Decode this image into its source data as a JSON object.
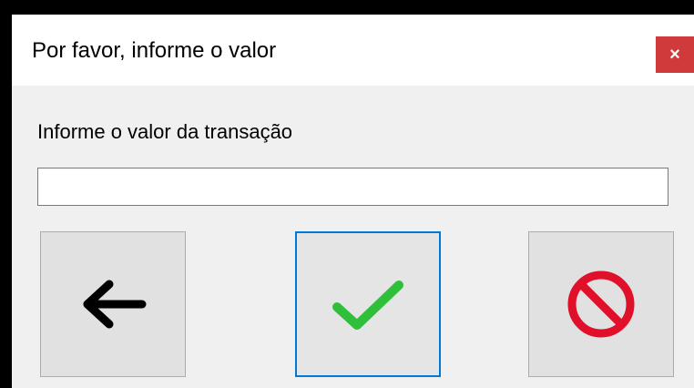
{
  "dialog": {
    "title": "Por favor, informe o valor",
    "close_label": "×"
  },
  "form": {
    "prompt_label": "Informe o valor da transação",
    "value": "",
    "placeholder": ""
  },
  "buttons": {
    "back_icon": "arrow-left-icon",
    "confirm_icon": "checkmark-icon",
    "cancel_icon": "prohibited-icon"
  },
  "colors": {
    "close_button": "#d03a3a",
    "confirm_focus_border": "#0078d7",
    "checkmark": "#2fbf3a",
    "prohibited": "#e0102a"
  }
}
